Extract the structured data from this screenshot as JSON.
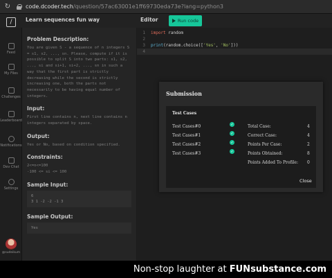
{
  "browser": {
    "url_host": "code.dcoder.tech",
    "url_path": "/question/57ac63001e1ff69730eda73e?lang=python3"
  },
  "header": {
    "logo_glyph": "/",
    "problem_title": "Learn sequences fun way",
    "editor_label": "Editor",
    "run_label": "Run code"
  },
  "sidebar": {
    "items": [
      {
        "label": "Feed",
        "icon": "feed-icon"
      },
      {
        "label": "My Files",
        "icon": "files-icon"
      },
      {
        "label": "Challenges",
        "icon": "trophy-icon"
      },
      {
        "label": "Leaderboard",
        "icon": "leaderboard-icon"
      },
      {
        "label": "Notifications",
        "icon": "bell-icon"
      },
      {
        "label": "Dev Chat",
        "icon": "chat-icon"
      },
      {
        "label": "Settings",
        "icon": "gear-icon"
      }
    ],
    "username": "@sudeikum"
  },
  "problem": {
    "description_head": "Problem Description:",
    "description_body": "You are given S - a sequence of n integers S = s1, s2, ..., sn. Please, compute if it is possible to split S into two parts: s1, s2, ..., si and si+1, si+2, ..., sn in such a way that the first part is strictly decreasing while the second is strictly increasing one, both the parts not necessarily to be having equal number of integers.",
    "input_head": "Input:",
    "input_body": "First line contains n, next line contains n integers separated by space.",
    "output_head": "Output:",
    "output_body": "Yes or No, based on condition specified.",
    "constraints_head": "Constraints:",
    "constraints_line1": "2<=n<=100",
    "constraints_line2": "-100 <= si <= 100",
    "sample_input_head": "Sample Input:",
    "sample_input_line1": "6",
    "sample_input_line2": "3 1 -2 -2 -1 3",
    "sample_output_head": "Sample Output:",
    "sample_output_body": "Yes"
  },
  "editor": {
    "lines": [
      {
        "num": "1",
        "kw": "import",
        "rest": " random"
      },
      {
        "num": "2"
      },
      {
        "num": "3",
        "fn": "print",
        "rest_a": "(random.choice([",
        "str1": "'Yes'",
        "sep": ", ",
        "str2": "'No'",
        "rest_b": "]))"
      },
      {
        "num": "4"
      }
    ]
  },
  "modal": {
    "title": "Submission",
    "test_cases_head": "Test Cases",
    "test_cases": [
      "Test Cases#0",
      "Test Cases#1",
      "Test Cases#2",
      "Test Cases#3"
    ],
    "stats": [
      {
        "label": "Total Case:",
        "value": "4"
      },
      {
        "label": "Correct Case:",
        "value": "4"
      },
      {
        "label": "Points Per Case:",
        "value": "2"
      },
      {
        "label": "Points Obtained:",
        "value": "8"
      },
      {
        "label": "Points Added To Profile:",
        "value": "0"
      }
    ],
    "close_label": "Close",
    "check_color": "#16c79a"
  },
  "watermark": {
    "text": "Non-stop laughter at ",
    "brand": "FUNsubstance.com"
  }
}
